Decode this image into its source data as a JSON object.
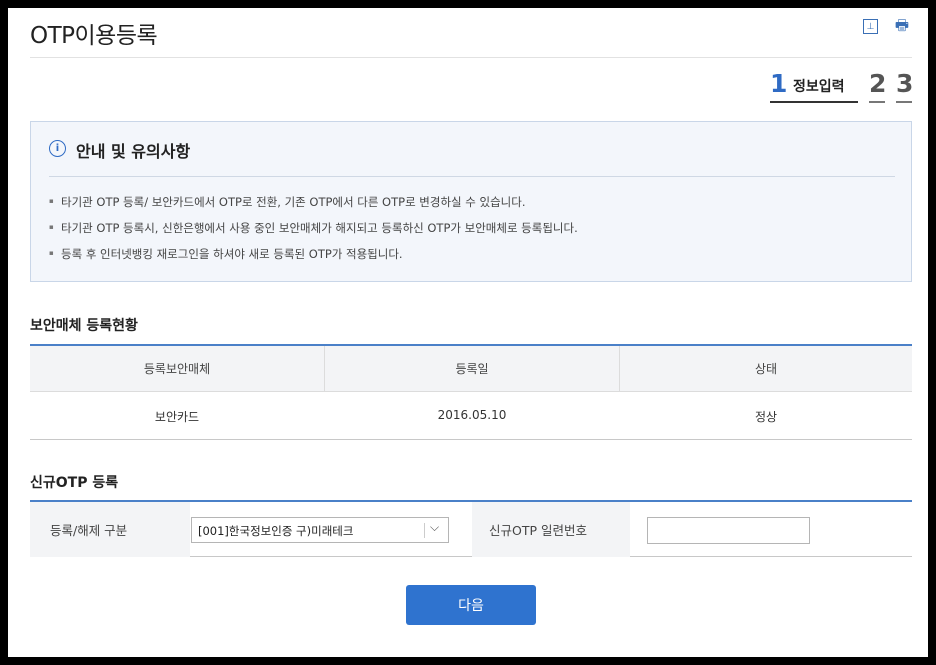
{
  "header": {
    "title": "OTP이용등록",
    "excel_icon_glyph": "⊥",
    "print_icon_glyph": "🖶"
  },
  "steps": {
    "current_number": "1",
    "current_label": "정보입력",
    "step2_number": "2",
    "step3_number": "3"
  },
  "notice": {
    "icon_glyph": "i",
    "title": "안내 및 유의사항",
    "items": [
      "타기관 OTP 등록/ 보안카드에서 OTP로 전환, 기존 OTP에서 다른 OTP로 변경하실 수 있습니다.",
      "타기관 OTP 등록시, 신한은행에서 사용 중인 보안매체가 해지되고 등록하신 OTP가 보안매체로 등록됩니다.",
      "등록 후 인터넷뱅킹 재로그인을 하셔야 새로 등록된 OTP가 적용됩니다."
    ]
  },
  "status_section": {
    "title": "보안매체 등록현황",
    "columns": [
      "등록보안매체",
      "등록일",
      "상태"
    ],
    "rows": [
      [
        "보안카드",
        "2016.05.10",
        "정상"
      ]
    ]
  },
  "register_section": {
    "title": "신규OTP 등록",
    "type_label": "등록/해제 구분",
    "select_value": "[001]한국정보인증 구)미래테크",
    "select_arrow_glyph": "⌵",
    "serial_label": "신규OTP 일련번호",
    "serial_value": ""
  },
  "actions": {
    "next_label": "다음"
  },
  "colors": {
    "accent": "#2f73cf",
    "table_border": "#4a80c8",
    "notice_bg": "#f3f6fb"
  }
}
